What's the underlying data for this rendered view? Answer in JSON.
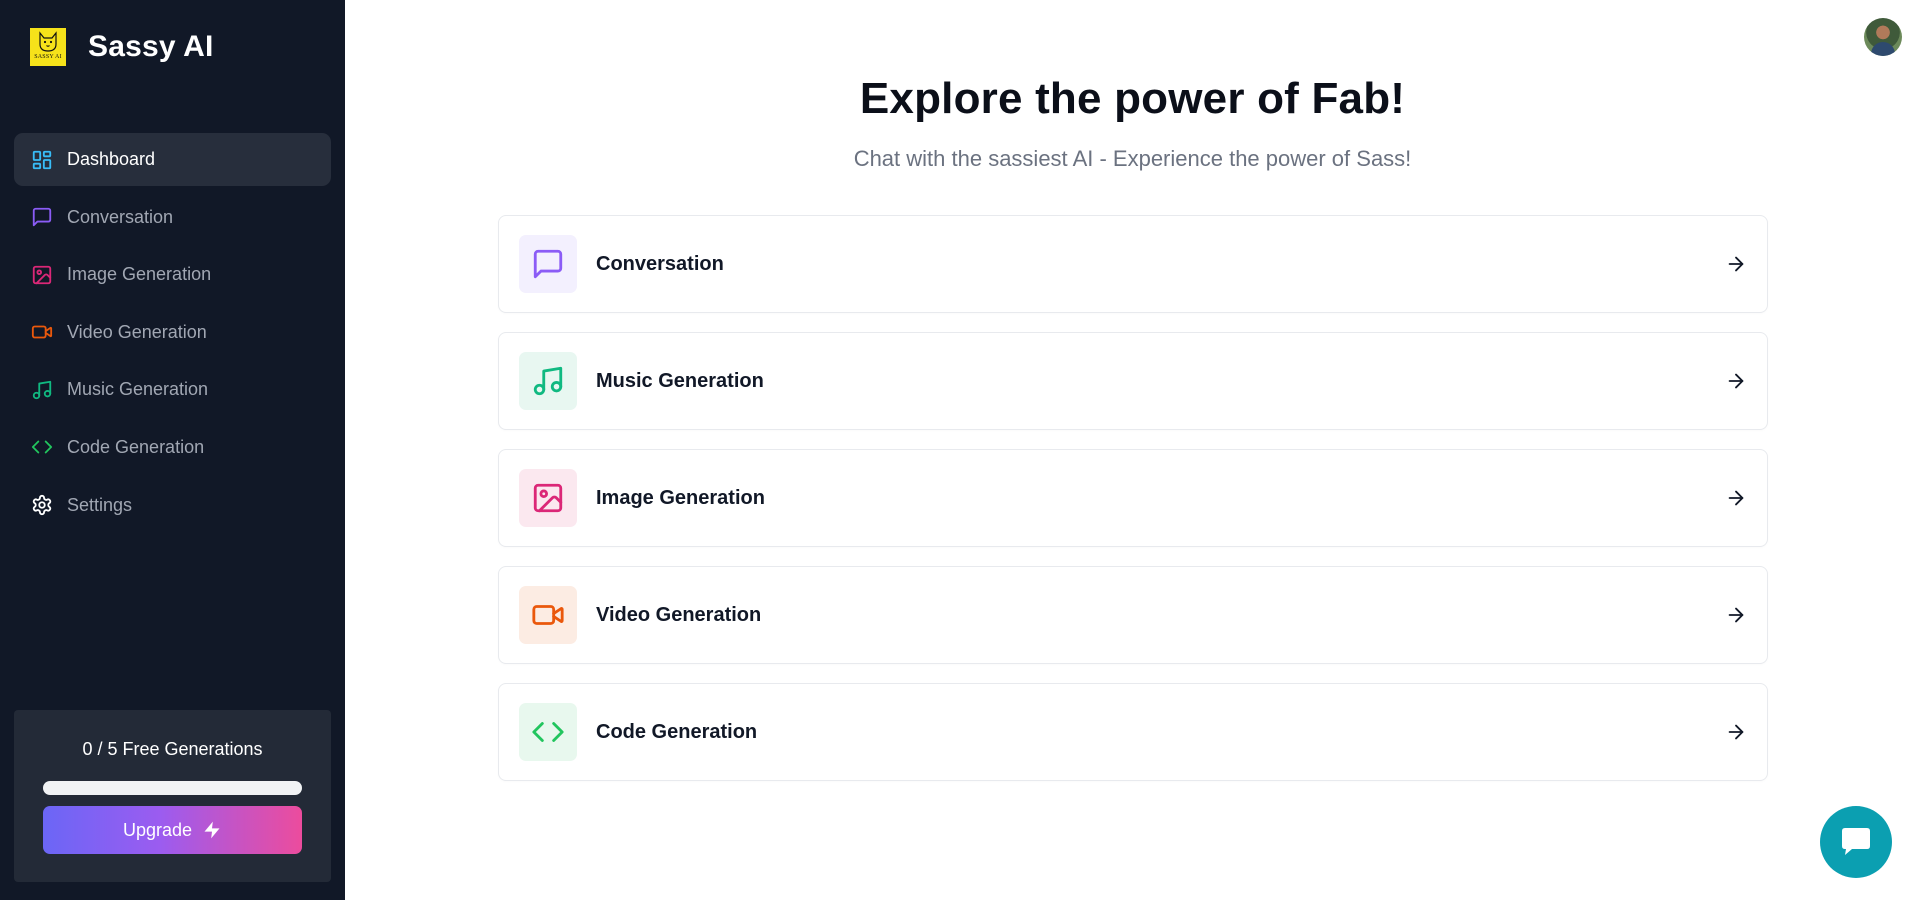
{
  "brand": {
    "name": "Sassy AI",
    "logo_text": "SASSY AI",
    "logo_color": "#f6e21a"
  },
  "sidebar": {
    "items": [
      {
        "label": "Dashboard",
        "icon": "layout-dashboard-icon",
        "color": "#38bdf8",
        "active": true
      },
      {
        "label": "Conversation",
        "icon": "message-square-icon",
        "color": "#8b5cf6",
        "active": false
      },
      {
        "label": "Image Generation",
        "icon": "image-icon",
        "color": "#db2777",
        "active": false
      },
      {
        "label": "Video Generation",
        "icon": "video-icon",
        "color": "#ea580c",
        "active": false
      },
      {
        "label": "Music Generation",
        "icon": "music-icon",
        "color": "#10b981",
        "active": false
      },
      {
        "label": "Code Generation",
        "icon": "code-icon",
        "color": "#22c55e",
        "active": false
      },
      {
        "label": "Settings",
        "icon": "settings-icon",
        "color": "#ffffff",
        "active": false
      }
    ]
  },
  "usage": {
    "text": "0 / 5 Free Generations",
    "used": 0,
    "limit": 5,
    "progress_fraction": 0
  },
  "upgrade": {
    "label": "Upgrade",
    "icon": "zap-icon"
  },
  "main": {
    "title": "Explore the power of Fab!",
    "subtitle": "Chat with the sassiest AI - Experience the power of Sass!"
  },
  "tools": [
    {
      "label": "Conversation",
      "icon": "message-square-icon",
      "color": "#8b5cf6",
      "bg": "#f3f0fe"
    },
    {
      "label": "Music Generation",
      "icon": "music-icon",
      "color": "#10b981",
      "bg": "#e8f7f1"
    },
    {
      "label": "Image Generation",
      "icon": "image-icon",
      "color": "#db2777",
      "bg": "#fbe8ef"
    },
    {
      "label": "Video Generation",
      "icon": "video-icon",
      "color": "#ea580c",
      "bg": "#fcece3"
    },
    {
      "label": "Code Generation",
      "icon": "code-icon",
      "color": "#22c55e",
      "bg": "#e8f8ee"
    }
  ],
  "support": {
    "icon": "chat-bubble-icon",
    "color": "#0b9fb1"
  }
}
